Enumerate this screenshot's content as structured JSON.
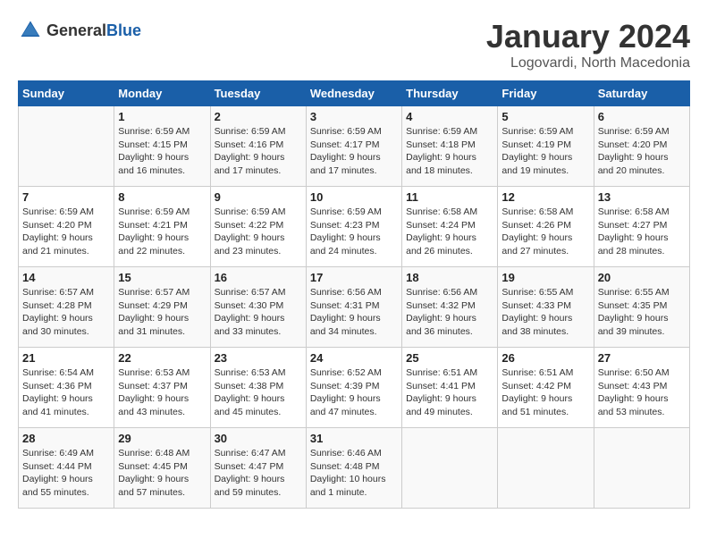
{
  "header": {
    "logo_general": "General",
    "logo_blue": "Blue",
    "title": "January 2024",
    "subtitle": "Logovardi, North Macedonia"
  },
  "days_of_week": [
    "Sunday",
    "Monday",
    "Tuesday",
    "Wednesday",
    "Thursday",
    "Friday",
    "Saturday"
  ],
  "weeks": [
    [
      {
        "day": "",
        "info": ""
      },
      {
        "day": "1",
        "info": "Sunrise: 6:59 AM\nSunset: 4:15 PM\nDaylight: 9 hours\nand 16 minutes."
      },
      {
        "day": "2",
        "info": "Sunrise: 6:59 AM\nSunset: 4:16 PM\nDaylight: 9 hours\nand 17 minutes."
      },
      {
        "day": "3",
        "info": "Sunrise: 6:59 AM\nSunset: 4:17 PM\nDaylight: 9 hours\nand 17 minutes."
      },
      {
        "day": "4",
        "info": "Sunrise: 6:59 AM\nSunset: 4:18 PM\nDaylight: 9 hours\nand 18 minutes."
      },
      {
        "day": "5",
        "info": "Sunrise: 6:59 AM\nSunset: 4:19 PM\nDaylight: 9 hours\nand 19 minutes."
      },
      {
        "day": "6",
        "info": "Sunrise: 6:59 AM\nSunset: 4:20 PM\nDaylight: 9 hours\nand 20 minutes."
      }
    ],
    [
      {
        "day": "7",
        "info": "Sunrise: 6:59 AM\nSunset: 4:20 PM\nDaylight: 9 hours\nand 21 minutes."
      },
      {
        "day": "8",
        "info": "Sunrise: 6:59 AM\nSunset: 4:21 PM\nDaylight: 9 hours\nand 22 minutes."
      },
      {
        "day": "9",
        "info": "Sunrise: 6:59 AM\nSunset: 4:22 PM\nDaylight: 9 hours\nand 23 minutes."
      },
      {
        "day": "10",
        "info": "Sunrise: 6:59 AM\nSunset: 4:23 PM\nDaylight: 9 hours\nand 24 minutes."
      },
      {
        "day": "11",
        "info": "Sunrise: 6:58 AM\nSunset: 4:24 PM\nDaylight: 9 hours\nand 26 minutes."
      },
      {
        "day": "12",
        "info": "Sunrise: 6:58 AM\nSunset: 4:26 PM\nDaylight: 9 hours\nand 27 minutes."
      },
      {
        "day": "13",
        "info": "Sunrise: 6:58 AM\nSunset: 4:27 PM\nDaylight: 9 hours\nand 28 minutes."
      }
    ],
    [
      {
        "day": "14",
        "info": "Sunrise: 6:57 AM\nSunset: 4:28 PM\nDaylight: 9 hours\nand 30 minutes."
      },
      {
        "day": "15",
        "info": "Sunrise: 6:57 AM\nSunset: 4:29 PM\nDaylight: 9 hours\nand 31 minutes."
      },
      {
        "day": "16",
        "info": "Sunrise: 6:57 AM\nSunset: 4:30 PM\nDaylight: 9 hours\nand 33 minutes."
      },
      {
        "day": "17",
        "info": "Sunrise: 6:56 AM\nSunset: 4:31 PM\nDaylight: 9 hours\nand 34 minutes."
      },
      {
        "day": "18",
        "info": "Sunrise: 6:56 AM\nSunset: 4:32 PM\nDaylight: 9 hours\nand 36 minutes."
      },
      {
        "day": "19",
        "info": "Sunrise: 6:55 AM\nSunset: 4:33 PM\nDaylight: 9 hours\nand 38 minutes."
      },
      {
        "day": "20",
        "info": "Sunrise: 6:55 AM\nSunset: 4:35 PM\nDaylight: 9 hours\nand 39 minutes."
      }
    ],
    [
      {
        "day": "21",
        "info": "Sunrise: 6:54 AM\nSunset: 4:36 PM\nDaylight: 9 hours\nand 41 minutes."
      },
      {
        "day": "22",
        "info": "Sunrise: 6:53 AM\nSunset: 4:37 PM\nDaylight: 9 hours\nand 43 minutes."
      },
      {
        "day": "23",
        "info": "Sunrise: 6:53 AM\nSunset: 4:38 PM\nDaylight: 9 hours\nand 45 minutes."
      },
      {
        "day": "24",
        "info": "Sunrise: 6:52 AM\nSunset: 4:39 PM\nDaylight: 9 hours\nand 47 minutes."
      },
      {
        "day": "25",
        "info": "Sunrise: 6:51 AM\nSunset: 4:41 PM\nDaylight: 9 hours\nand 49 minutes."
      },
      {
        "day": "26",
        "info": "Sunrise: 6:51 AM\nSunset: 4:42 PM\nDaylight: 9 hours\nand 51 minutes."
      },
      {
        "day": "27",
        "info": "Sunrise: 6:50 AM\nSunset: 4:43 PM\nDaylight: 9 hours\nand 53 minutes."
      }
    ],
    [
      {
        "day": "28",
        "info": "Sunrise: 6:49 AM\nSunset: 4:44 PM\nDaylight: 9 hours\nand 55 minutes."
      },
      {
        "day": "29",
        "info": "Sunrise: 6:48 AM\nSunset: 4:45 PM\nDaylight: 9 hours\nand 57 minutes."
      },
      {
        "day": "30",
        "info": "Sunrise: 6:47 AM\nSunset: 4:47 PM\nDaylight: 9 hours\nand 59 minutes."
      },
      {
        "day": "31",
        "info": "Sunrise: 6:46 AM\nSunset: 4:48 PM\nDaylight: 10 hours\nand 1 minute."
      },
      {
        "day": "",
        "info": ""
      },
      {
        "day": "",
        "info": ""
      },
      {
        "day": "",
        "info": ""
      }
    ]
  ]
}
